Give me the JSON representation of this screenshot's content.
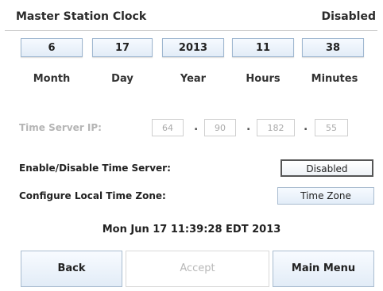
{
  "header": {
    "title": "Master Station Clock",
    "status": "Disabled"
  },
  "datetime_fields": [
    {
      "label": "Month",
      "value": "6"
    },
    {
      "label": "Day",
      "value": "17"
    },
    {
      "label": "Year",
      "value": "2013"
    },
    {
      "label": "Hours",
      "value": "11"
    },
    {
      "label": "Minutes",
      "value": "38"
    }
  ],
  "time_server": {
    "label": "Time Server IP:",
    "octets": [
      "64",
      "90",
      "182",
      "55"
    ],
    "separator": "."
  },
  "enable_row": {
    "label": "Enable/Disable Time Server:",
    "button": "Disabled"
  },
  "timezone_row": {
    "label": "Configure Local Time Zone:",
    "button": "Time Zone"
  },
  "current_datetime": "Mon Jun 17 11:39:28 EDT 2013",
  "footer": {
    "back": "Back",
    "accept": "Accept",
    "main_menu": "Main Menu"
  }
}
